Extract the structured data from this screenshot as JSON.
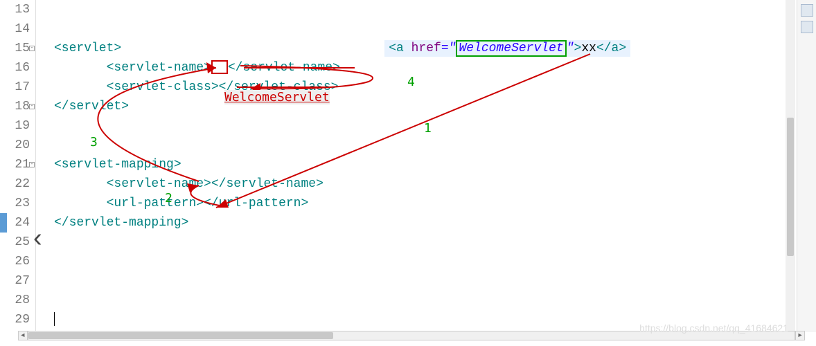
{
  "lines": {
    "13": "13",
    "14": "14",
    "15": "15",
    "16": "16",
    "17": "17",
    "18": "18",
    "19": "19",
    "20": "20",
    "21": "21",
    "22": "22",
    "23": "23",
    "24": "24",
    "25": "25",
    "26": "26",
    "27": "27",
    "28": "28",
    "29": "29"
  },
  "code": {
    "servlet_open": "<servlet>",
    "servlet_name_open": "<servlet-name>",
    "servlet_name_close": "</servlet-name>",
    "servlet_class_open": "<servlet-class>",
    "servlet_class_close": "</servlet-class>",
    "servlet_close": "</servlet>",
    "servlet_mapping_open": "<servlet-mapping>",
    "servlet_mapping_close": "</servlet-mapping>",
    "url_pattern_open": "<url-pattern>",
    "url_pattern_close": "</url-pattern>",
    "a_open": "<a",
    "href_attr": "href",
    "eq": "=\"",
    "href_value": "WelcomeServlet",
    "href_end": "\"",
    "a_gt": ">",
    "link_text": "xx",
    "a_close": "</a>"
  },
  "annotations": {
    "welcome_label": "WelcomeServlet",
    "num1": "1",
    "num2": "2",
    "num3": "3",
    "num4": "4"
  },
  "watermark": "https://blog.csdn.net/qq_41684621"
}
